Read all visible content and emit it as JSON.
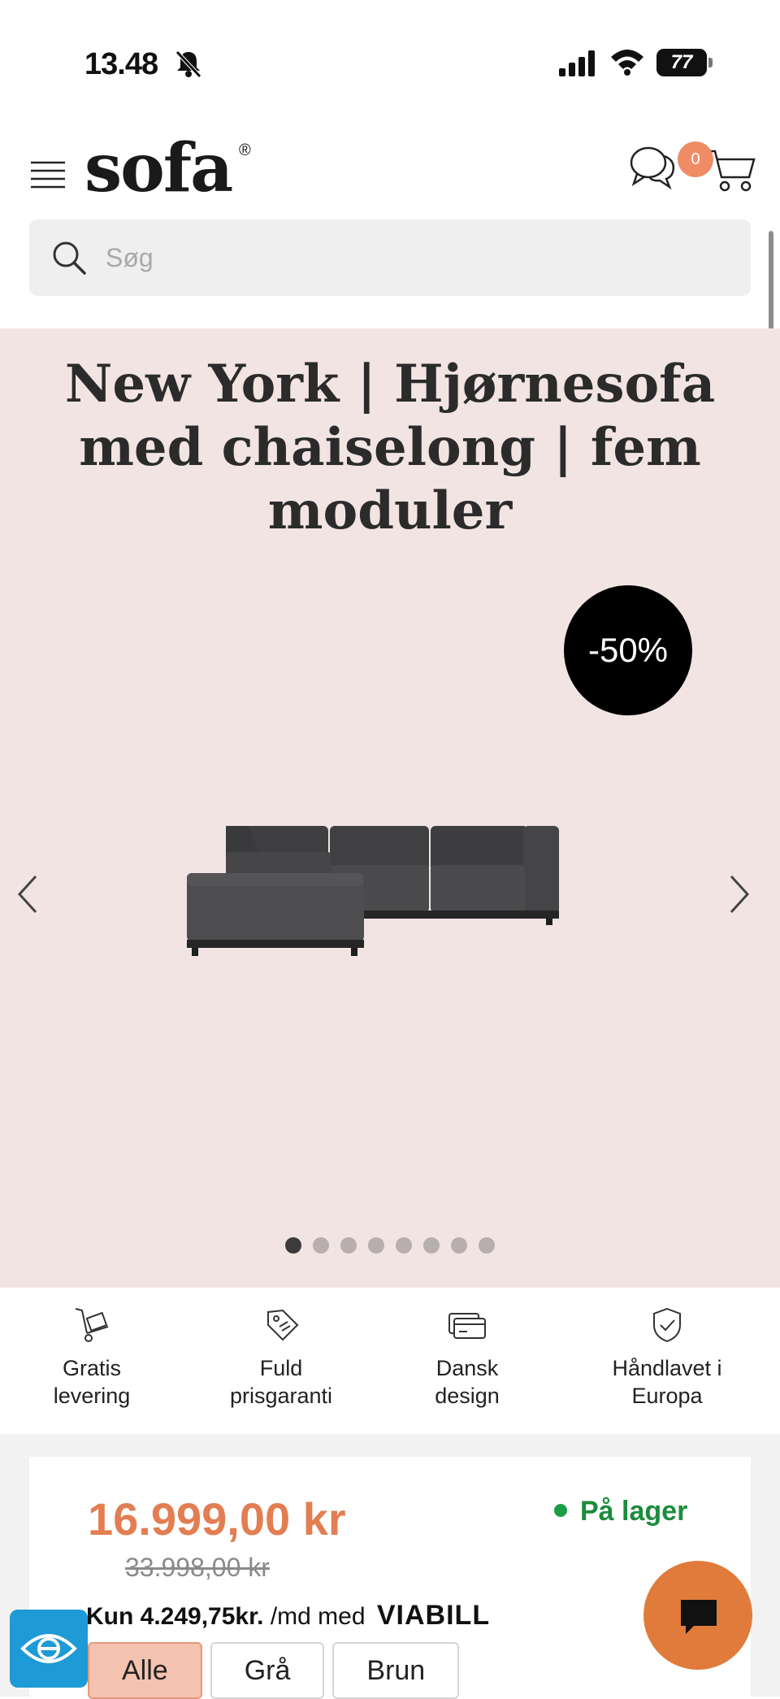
{
  "status_bar": {
    "time": "13.48",
    "battery": "77"
  },
  "header": {
    "logo": "sofa",
    "logo_mark": "®",
    "cart_count": "0"
  },
  "search": {
    "placeholder": "Søg"
  },
  "product": {
    "title": "New York | Hjørnesofa med chaiselong | fem moduler",
    "discount": "-50%",
    "gallery_dots": 8,
    "gallery_active": 0
  },
  "features": [
    {
      "icon": "delivery-cart-icon",
      "label": "Gratis\nlevering"
    },
    {
      "icon": "price-tag-icon",
      "label": "Fuld\nprisgaranti"
    },
    {
      "icon": "credit-card-icon",
      "label": "Dansk\ndesign"
    },
    {
      "icon": "shield-check-icon",
      "label": "Håndlavet i\nEuropa"
    }
  ],
  "pricing": {
    "current_price": "16.999,00 kr",
    "old_price": "33.998,00 kr",
    "stock": "På lager",
    "viabill_prefix": "Kun 4.249,75kr.",
    "viabill_suffix": "/md med",
    "viabill_brand": "VIABILL"
  },
  "variants": [
    {
      "label": "Alle",
      "active": true
    },
    {
      "label": "Grå",
      "active": false
    },
    {
      "label": "Brun",
      "active": false
    }
  ],
  "colors": {
    "accent": "#e27e52",
    "hero_bg": "#f1e4e3",
    "stock_green": "#1b8c3c",
    "fab_orange": "#e07b3c",
    "badge_bg": "#000000"
  }
}
